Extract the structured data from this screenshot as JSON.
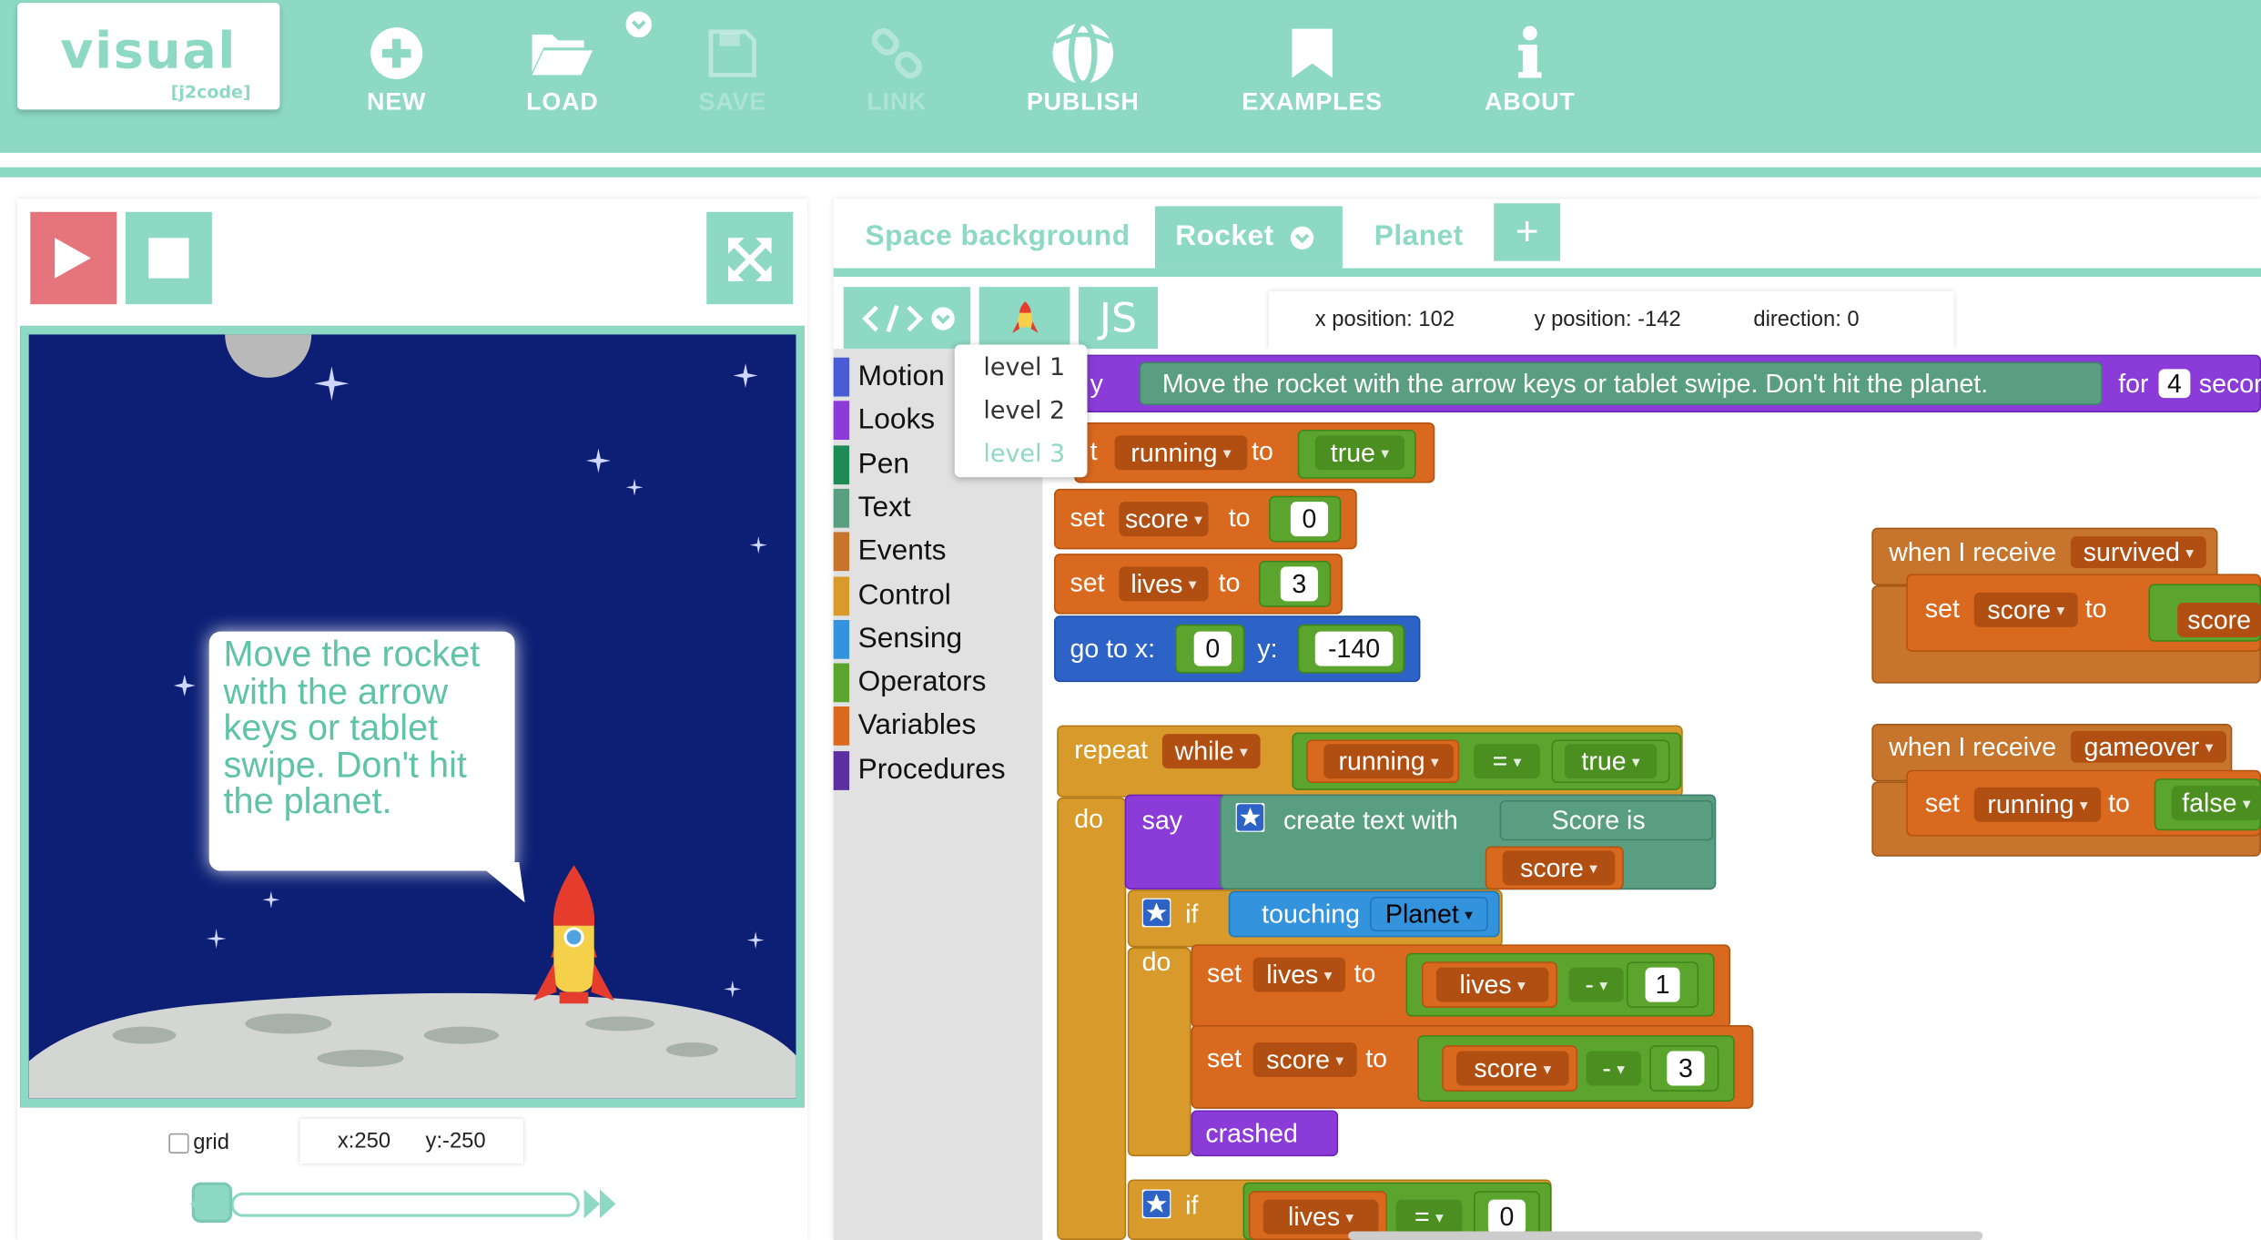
{
  "header": {
    "logo_text": "visual",
    "logo_subtext": "[j2code]",
    "buttons": [
      {
        "label": "NEW",
        "icon": "plus-circle-icon"
      },
      {
        "label": "LOAD",
        "icon": "folder-open-icon"
      },
      {
        "label": "SAVE",
        "icon": "floppy-disk-icon",
        "disabled": true
      },
      {
        "label": "LINK",
        "icon": "chain-link-icon",
        "disabled": true
      },
      {
        "label": "PUBLISH",
        "icon": "globe-icon"
      },
      {
        "label": "EXAMPLES",
        "icon": "bookmark-icon"
      },
      {
        "label": "ABOUT",
        "icon": "info-icon"
      }
    ],
    "accent_color": "#8dd9c3"
  },
  "stage": {
    "speech_bubble": "Move the rocket with the arrow keys or tablet swipe. Don't hit the planet.",
    "grid_label": "grid",
    "coord_x": "x:250",
    "coord_y": "y:-250"
  },
  "editor": {
    "tabs": [
      {
        "label": "Space background"
      },
      {
        "label": "Rocket",
        "active": true
      },
      {
        "label": "Planet"
      }
    ],
    "add_tab_symbol": "+",
    "js_label": "JS",
    "position": {
      "x": "x position: 102",
      "y": "y position: -142",
      "direction": "direction: 0"
    },
    "level_menu": [
      "level 1",
      "level 2",
      "level 3"
    ],
    "categories": [
      {
        "label": "Motion",
        "color": "#4a5bd6"
      },
      {
        "label": "Looks",
        "color": "#8a3bd8"
      },
      {
        "label": "Pen",
        "color": "#1f8a55"
      },
      {
        "label": "Text",
        "color": "#5a9e82"
      },
      {
        "label": "Events",
        "color": "#c7742d"
      },
      {
        "label": "Control",
        "color": "#d79a2b"
      },
      {
        "label": "Sensing",
        "color": "#3394dd"
      },
      {
        "label": "Operators",
        "color": "#5ba52f"
      },
      {
        "label": "Variables",
        "color": "#d9691f"
      },
      {
        "label": "Procedures",
        "color": "#5b2fa0"
      }
    ],
    "blocks": {
      "say_top": {
        "prefix": "y",
        "text": "Move the rocket with the arrow keys or tablet swipe. Don't hit the planet.",
        "for": "for",
        "secs": "4",
        "suffix": "secor"
      },
      "set_running": {
        "set": "t",
        "var": "running",
        "to": "to",
        "val": "true"
      },
      "set_score": {
        "set": "set",
        "var": "score",
        "to": "to",
        "val": "0"
      },
      "set_lives": {
        "set": "set",
        "var": "lives",
        "to": "to",
        "val": "3"
      },
      "goto": {
        "label": "go to x:",
        "x": "0",
        "ylabel": "y:",
        "y": "-140"
      },
      "repeat": {
        "label": "repeat",
        "mode": "while",
        "var": "running",
        "op": "=",
        "val": "true",
        "do": "do"
      },
      "say_score": {
        "say": "say",
        "create": "create text with",
        "text": "Score is",
        "var": "score"
      },
      "if_touch": {
        "if": "if",
        "touching": "touching",
        "target": "Planet",
        "do": "do"
      },
      "set_lives2": {
        "set": "set",
        "var": "lives",
        "to": "to",
        "a": "lives",
        "op": "-",
        "b": "1"
      },
      "set_score2": {
        "set": "set",
        "var": "score",
        "to": "to",
        "a": "score",
        "op": "-",
        "b": "3"
      },
      "crashed": "crashed",
      "if_lives": {
        "if": "if",
        "var": "lives",
        "op": "=",
        "val": "0"
      },
      "recv_survived": {
        "label": "when I receive",
        "msg": "survived",
        "set": "set",
        "var": "score",
        "to": "to",
        "val": "score"
      },
      "recv_gameover": {
        "label": "when I receive",
        "msg": "gameover",
        "set": "set",
        "var": "running",
        "to": "to",
        "val": "false"
      }
    }
  }
}
